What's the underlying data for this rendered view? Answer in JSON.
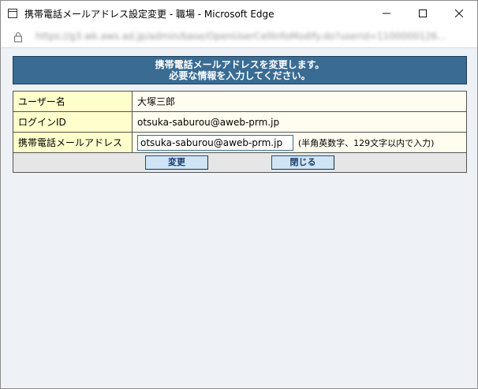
{
  "window": {
    "title": "携帯電話メールアドレス設定変更 - 職場 - Microsoft Edge",
    "url": "https://g3.wk.aws.ad.jp/admin/base/OpenUserCellInfoModify.do?userid=1100000126..."
  },
  "header": {
    "line1": "携帯電話メールアドレスを変更します。",
    "line2": "必要な情報を入力してください。"
  },
  "form": {
    "rows": [
      {
        "label": "ユーザー名",
        "value": "大塚三郎"
      },
      {
        "label": "ログインID",
        "value": "otsuka-saburou@aweb-prm.jp"
      },
      {
        "label": "携帯電話メールアドレス",
        "value": "otsuka-saburou@aweb-prm.jp"
      }
    ],
    "email_hint": "(半角英数字、129文字以内で入力)"
  },
  "buttons": {
    "change": "変更",
    "close": "閉じる"
  },
  "colors": {
    "header_bg": "#3a6c93",
    "label_bg": "#ffffcc",
    "button_bg": "#cfe5f5",
    "page_bg": "#eef1f6"
  }
}
